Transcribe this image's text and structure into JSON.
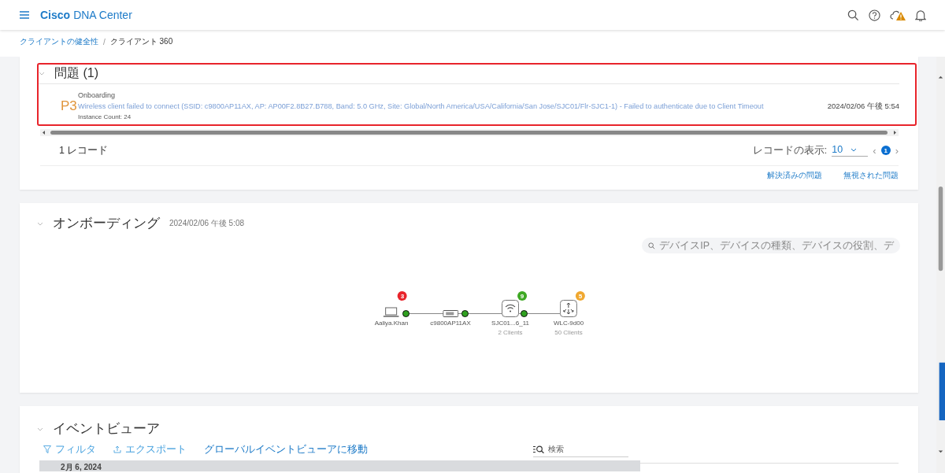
{
  "header": {
    "brand_bold": "Cisco",
    "brand": "DNA Center"
  },
  "breadcrumb": [
    {
      "label": "クライアントの健全性",
      "kind": "link"
    },
    {
      "label": "/",
      "kind": "separator"
    },
    {
      "label": "クライアント 360",
      "kind": "current"
    }
  ],
  "issues": {
    "title": "問題 (1)",
    "highlighted": true,
    "items": [
      {
        "priority": "P3",
        "category": "Onboarding",
        "description": "Wireless client failed to connect (SSID: c9800AP11AX, AP: AP00F2.8B27.B788, Band: 5.0 GHz, Site: Global/North America/USA/California/San Jose/SJC01/Flr-SJC1-1) - Failed to authenticate due to Client Timeout",
        "instance": "Instance Count: 24",
        "time": "2024/02/06 午後 5:54"
      }
    ],
    "records": "1 レコード",
    "page_size_label": "レコードの表示:",
    "page_size": "10",
    "prev": "‹",
    "next": "›",
    "pages": [
      {
        "label": "1",
        "selected": true
      }
    ],
    "links": [
      "解決済みの問題",
      "無視された問題"
    ]
  },
  "onboarding": {
    "title": "オンボーディング",
    "time": "2024/02/06 午後 5:08",
    "search": {
      "placeholder": "デバイスIP、デバイスの種類、デバイスの役割、デ"
    },
    "nodes": [
      {
        "kind": "laptop",
        "label": "Aaliya.Khan",
        "badge": "3",
        "color": "#e8242b"
      },
      {
        "kind": "adapter",
        "label": "c9800AP11AX"
      },
      {
        "kind": "wifi",
        "label": "SJC01...6_11",
        "sublabel": "2 Clients",
        "badge": "9",
        "color": "#3ea823"
      },
      {
        "kind": "router",
        "label": "WLC-9d00",
        "sublabel": "50 Clients",
        "badge": "5",
        "color": "#f0a830"
      }
    ]
  },
  "events": {
    "title": "イベントビューア",
    "actions": [
      {
        "kind": "filter",
        "label": "フィルタ"
      },
      {
        "kind": "export",
        "label": "エクスポート"
      },
      {
        "kind": "link",
        "label": "グローバルイベントビューアに移動"
      }
    ],
    "search": {
      "placeholder": "検索"
    },
    "date": "2月 6, 2024"
  }
}
